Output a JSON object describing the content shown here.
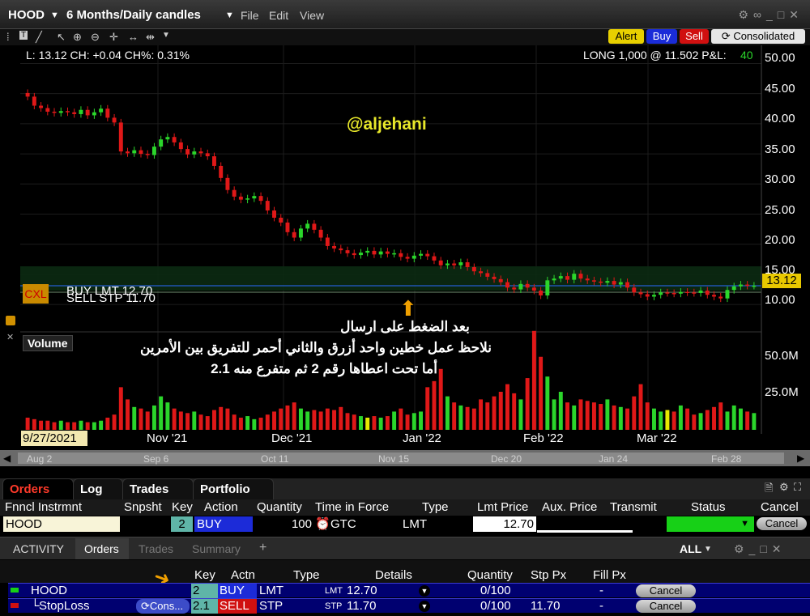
{
  "window": {
    "symbol": "HOOD",
    "timeframe": "6 Months/Daily candles",
    "menu": [
      "File",
      "Edit",
      "View"
    ]
  },
  "toolbar": {
    "alert": "Alert",
    "buy": "Buy",
    "sell": "Sell",
    "consolidated": "Consolidated"
  },
  "chart_info": {
    "last_line": "L: 13.12 CH: +0.04 CH%: 0.31%",
    "position_line": "LONG 1,000 @ 11.502 P&L:",
    "pnl": "40",
    "watermark": "@aljehani",
    "price_tag": "13.12",
    "cxl": "CXL",
    "buy_order": "BUY LMT 12.70",
    "sell_order": "SELL STP 11.70",
    "volume_label": "Volume",
    "start_date": "9/27/2021"
  },
  "annotation": {
    "line1": "بعد الضغط على ارسال",
    "line2": "نلاحظ عمل خطين واحد أزرق والثاني أحمر للتفريق بين الأمرين",
    "line3": "أما تحت اعطاها رقم 2 ثم متفرع منه 2.1"
  },
  "chart_data": {
    "type": "candlestick",
    "price_axis": [
      "50.00",
      "45.00",
      "40.00",
      "35.00",
      "30.00",
      "25.00",
      "20.00",
      "15.00",
      "10.00"
    ],
    "volume_axis": [
      "50.0M",
      "25.0M"
    ],
    "x_labels": [
      "Nov '21",
      "Dec '21",
      "Jan '22",
      "Feb '22",
      "Mar '22"
    ],
    "ylim": [
      8,
      51
    ],
    "closes": [
      44.5,
      43.0,
      42.6,
      42.0,
      41.8,
      42.1,
      41.9,
      41.6,
      42.3,
      41.4,
      41.9,
      42.5,
      41.0,
      40.2,
      35.4,
      35.1,
      35.6,
      35.0,
      34.8,
      36.2,
      37.4,
      37.8,
      36.9,
      35.8,
      34.9,
      35.4,
      35.1,
      34.6,
      33.0,
      31.0,
      29.0,
      27.9,
      27.4,
      27.6,
      28.0,
      27.2,
      25.6,
      24.4,
      23.6,
      22.0,
      21.1,
      22.6,
      23.4,
      22.4,
      21.1,
      19.7,
      19.3,
      19.0,
      18.5,
      18.2,
      18.6,
      18.9,
      18.3,
      18.8,
      18.4,
      18.5,
      17.9,
      17.6,
      18.1,
      18.4,
      18.0,
      17.3,
      16.5,
      16.8,
      16.5,
      17.0,
      16.2,
      15.5,
      15.2,
      14.6,
      14.2,
      13.7,
      12.8,
      12.5,
      13.4,
      12.8,
      12.3,
      11.5,
      14.0,
      14.3,
      14.7,
      14.1,
      15.1,
      14.3,
      14.0,
      13.8,
      13.6,
      13.9,
      13.3,
      13.7,
      12.8,
      12.0,
      11.7,
      11.3,
      11.6,
      12.0,
      11.9,
      11.8,
      12.1,
      12.0,
      11.9,
      12.3,
      11.6,
      11.3,
      11.0,
      12.4,
      13.0,
      13.3,
      13.1,
      13.12
    ],
    "volumes_m": [
      8,
      7,
      6,
      6,
      5,
      6,
      5,
      5,
      6,
      5,
      5,
      6,
      8,
      10,
      28,
      20,
      15,
      14,
      12,
      16,
      22,
      18,
      14,
      12,
      11,
      12,
      10,
      9,
      13,
      15,
      14,
      10,
      8,
      9,
      7,
      8,
      10,
      12,
      14,
      16,
      18,
      14,
      12,
      13,
      12,
      14,
      13,
      15,
      11,
      10,
      9,
      8,
      9,
      8,
      9,
      12,
      14,
      10,
      11,
      12,
      28,
      32,
      40,
      22,
      18,
      16,
      15,
      14,
      20,
      18,
      22,
      25,
      30,
      24,
      20,
      34,
      65,
      48,
      35,
      20,
      25,
      18,
      16,
      20,
      19,
      18,
      17,
      20,
      16,
      15,
      14,
      22,
      30,
      18,
      14,
      12,
      13,
      12,
      16,
      14,
      10,
      11,
      13,
      15,
      18,
      12,
      16,
      14,
      12,
      11
    ]
  },
  "scroll_labels": [
    "Aug 2",
    "Sep 6",
    "Oct 11",
    "Nov 15",
    "Dec 20",
    "Jan 24",
    "Feb 28"
  ],
  "orders_tabs": [
    "Orders",
    "Log",
    "Trades",
    "Portfolio"
  ],
  "order_headers": [
    "Fnncl Instrmnt",
    "Snpsht",
    "Key",
    "Action",
    "Quantity",
    "Time in Force",
    "Type",
    "Lmt Price",
    "Aux. Price",
    "Transmit",
    "Status",
    "Cancel"
  ],
  "order_row": {
    "instrument": "HOOD",
    "key": "2",
    "action": "BUY",
    "quantity": "100",
    "tif": "GTC",
    "type": "LMT",
    "lmt_price": "12.70",
    "cancel": "Cancel"
  },
  "activity_tabs": [
    "ACTIVITY",
    "Orders",
    "Trades",
    "Summary",
    "+"
  ],
  "activity_filter": "ALL",
  "activity_headers": [
    "Key",
    "Actn",
    "Type",
    "Details",
    "Quantity",
    "Stp Px",
    "Fill Px"
  ],
  "activity_rows": [
    {
      "name": "HOOD",
      "key": "2",
      "action": "BUY",
      "type": "LMT",
      "detail_type": "LMT",
      "detail_price": "12.70",
      "quantity": "0/100",
      "stp_px": "",
      "fill_px": "-",
      "cancel": "Cancel"
    },
    {
      "name": "StopLoss",
      "cons": "Cons...",
      "key": "2.1",
      "action": "SELL",
      "type": "STP",
      "detail_type": "STP",
      "detail_price": "11.70",
      "quantity": "0/100",
      "stp_px": "11.70",
      "fill_px": "-",
      "cancel": "Cancel"
    }
  ]
}
